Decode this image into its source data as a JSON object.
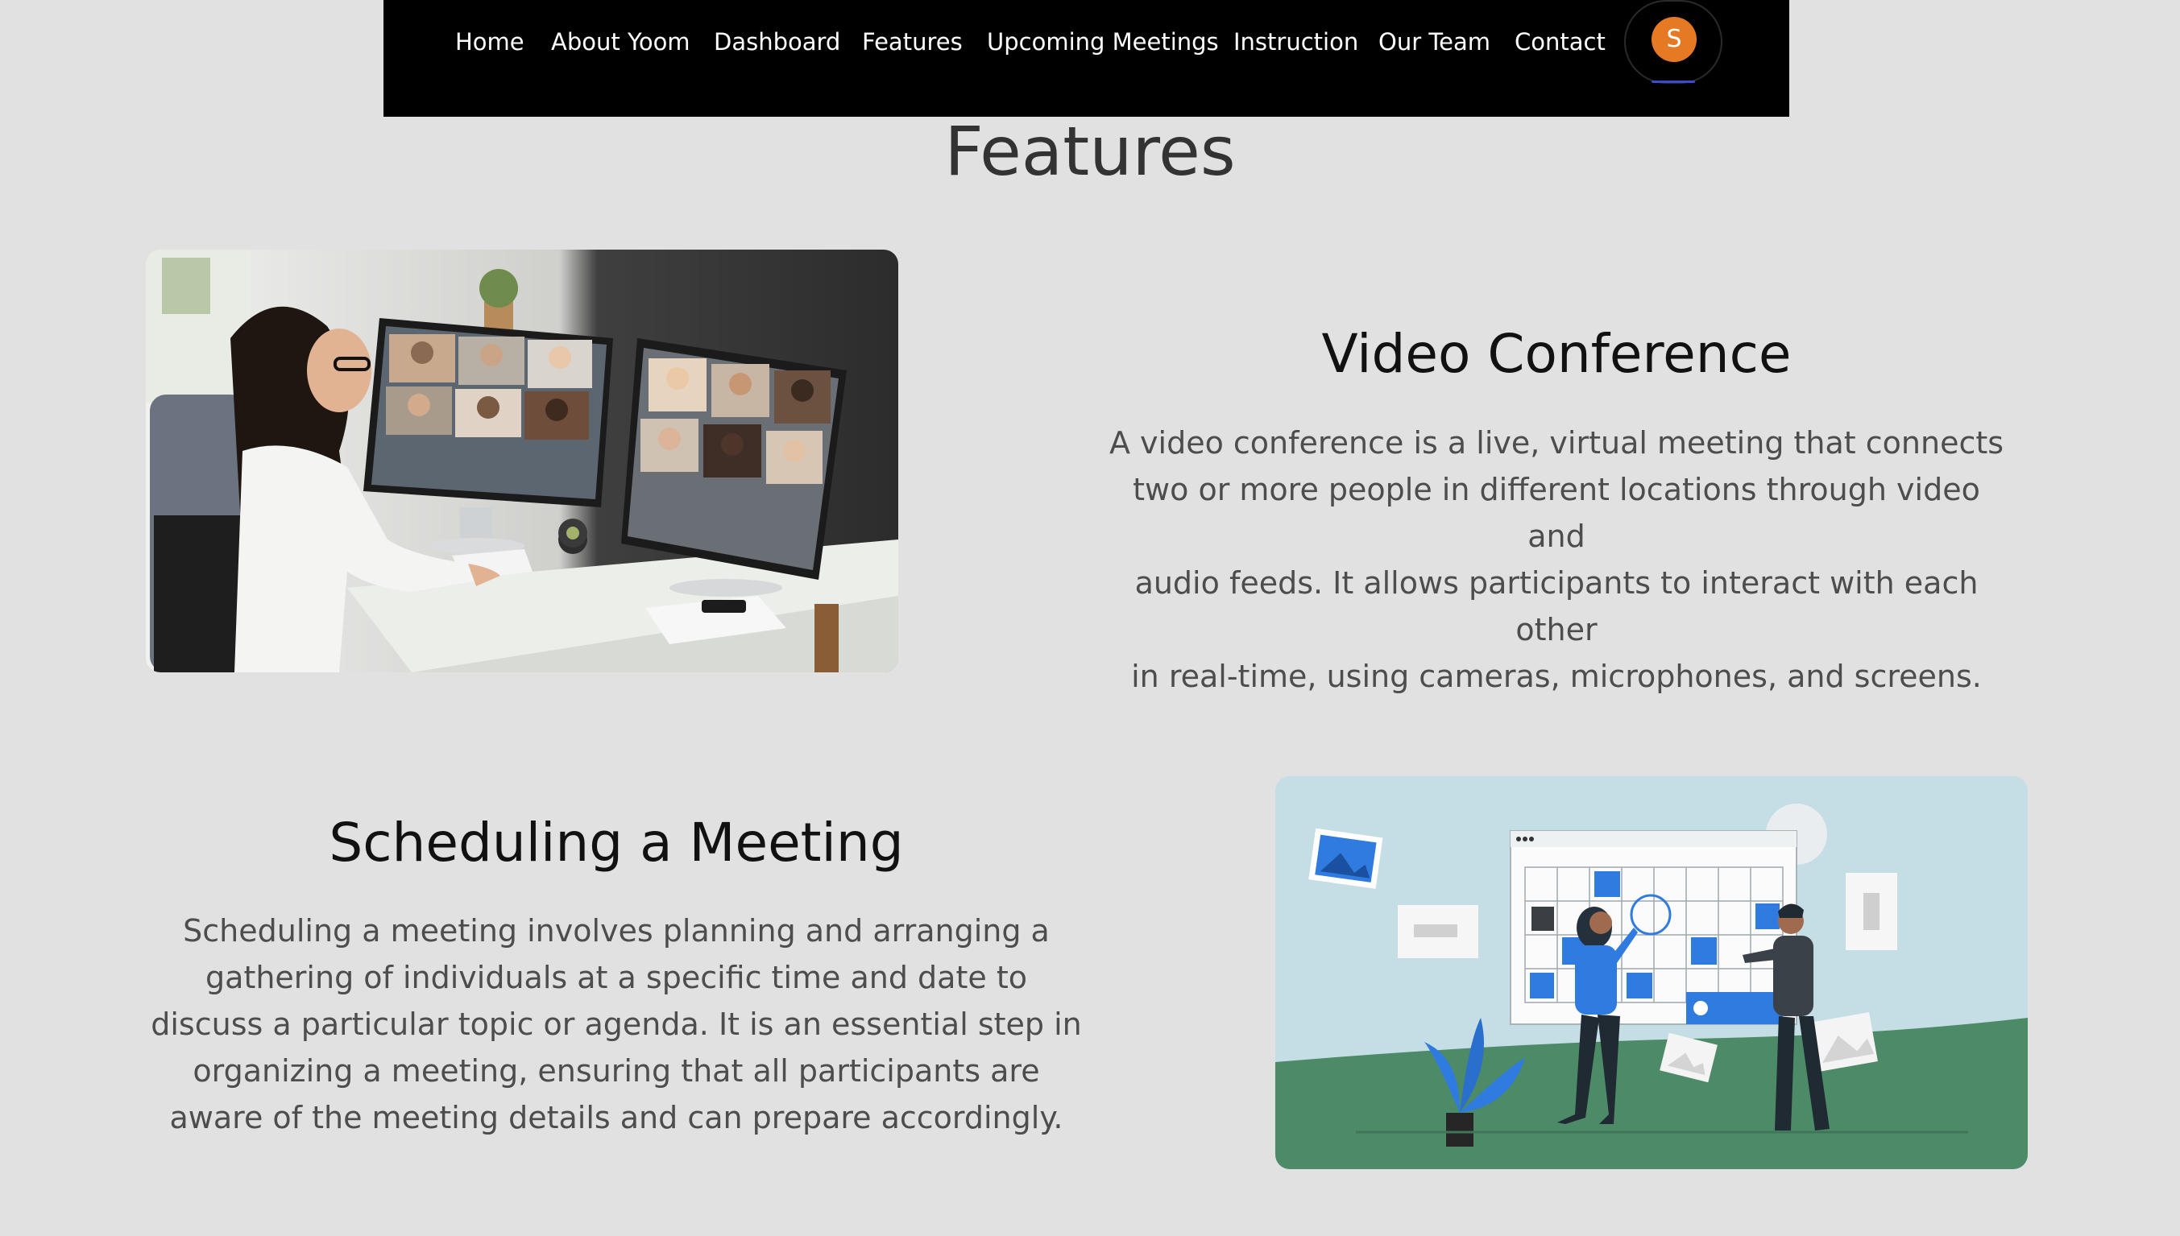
{
  "nav": {
    "items": [
      "Home",
      "About Yoom",
      "Dashboard",
      "Features",
      "Upcoming Meetings",
      "Instruction",
      "Our Team",
      "Contact"
    ],
    "avatar_initial": "S"
  },
  "page": {
    "title": "Features"
  },
  "features": [
    {
      "heading": "Video Conference",
      "lines": [
        "A video conference is a live, virtual meeting that connects",
        "two or more people in different locations through video and",
        "audio feeds. It allows participants to interact with each other",
        "in real-time, using cameras, microphones, and screens."
      ],
      "image": "video-conference-photo"
    },
    {
      "heading": "Scheduling a Meeting",
      "lines": [
        "Scheduling a meeting involves planning and arranging a",
        "gathering of individuals at a specific time and date to",
        "discuss a particular topic or agenda. It is an essential step in",
        "organizing a meeting, ensuring that all participants are",
        "aware of the meeting details and can prepare accordingly."
      ],
      "image": "scheduling-illustration"
    }
  ],
  "colors": {
    "background": "#e1e1e1",
    "navbar": "#000000",
    "avatar": "#e67a24",
    "illustration_sky": "#c5dde4",
    "illustration_ground": "#4d8a68",
    "accent_blue": "#2f7be0"
  }
}
